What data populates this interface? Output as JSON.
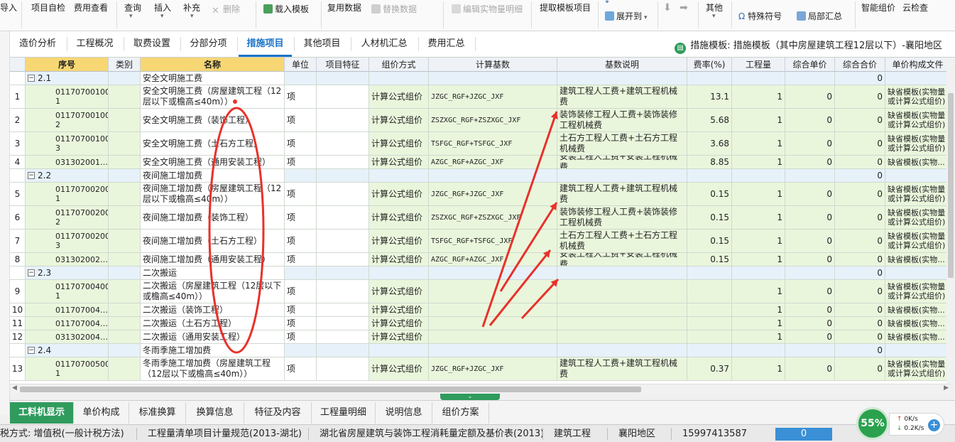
{
  "toolbar": {
    "items": [
      {
        "key": "import",
        "label": "导入",
        "disabled": false
      },
      {
        "key": "self_check",
        "label": "项目自检",
        "disabled": false
      },
      {
        "key": "fee_view",
        "label": "费用查看",
        "disabled": false
      },
      {
        "key": "query",
        "label": "查询",
        "disabled": false
      },
      {
        "key": "insert",
        "label": "插入",
        "disabled": false
      },
      {
        "key": "supplement",
        "label": "补充",
        "disabled": false
      },
      {
        "key": "delete",
        "label": "删除",
        "disabled": true
      },
      {
        "key": "load_template",
        "label": "载入模板",
        "disabled": false
      },
      {
        "key": "reuse_data",
        "label": "复用数据",
        "disabled": false
      },
      {
        "key": "replace_data",
        "label": "替换数据",
        "disabled": true
      },
      {
        "key": "edit_detail",
        "label": "编辑实物量明细",
        "disabled": true
      },
      {
        "key": "extract_template",
        "label": "提取模板项目",
        "disabled": false
      },
      {
        "key": "expand_to",
        "label": "展开到",
        "disabled": false
      },
      {
        "key": "other",
        "label": "其他",
        "disabled": false
      },
      {
        "key": "special_symbol",
        "label": "特殊符号",
        "disabled": false
      },
      {
        "key": "partial_summary",
        "label": "局部汇总",
        "disabled": false
      },
      {
        "key": "smart_pricing",
        "label": "智能组价",
        "disabled": false
      },
      {
        "key": "cloud_check",
        "label": "云检查",
        "disabled": false
      }
    ]
  },
  "tabs": {
    "items": [
      "造价分析",
      "工程概况",
      "取费设置",
      "分部分项",
      "措施项目",
      "其他项目",
      "人材机汇总",
      "费用汇总"
    ],
    "active_index": 4,
    "template_info": "措施模板: 措施模板（其中房屋建筑工程12层以下）-襄阳地区"
  },
  "grid": {
    "headers": [
      "序号",
      "类别",
      "名称",
      "单位",
      "项目特征",
      "组价方式",
      "计算基数",
      "基数说明",
      "费率(%)",
      "工程量",
      "综合单价",
      "综合合价",
      "单价构成文件"
    ],
    "highlight_headers": [
      0,
      2
    ],
    "rows": [
      {
        "type": "group",
        "seq": "2.1",
        "name": "安全文明施工费",
        "total": "0"
      },
      {
        "type": "item",
        "rn": "1",
        "seq": "01170700100\n1",
        "name": "安全文明施工费（房屋建筑工程（12层以下或檐高≤40m））",
        "unit": "项",
        "method": "计算公式组价",
        "base": "JZGC_RGF+JZGC_JXF",
        "desc": "建筑工程人工费+建筑工程机械费",
        "rate": "13.1",
        "qty": "1",
        "price": "0",
        "total": "0",
        "file": "缺省模板(实物量或计算公式组价)"
      },
      {
        "type": "item",
        "rn": "2",
        "seq": "01170700100\n2",
        "name": "安全文明施工费（装饰工程）",
        "unit": "项",
        "method": "计算公式组价",
        "base": "ZSZXGC_RGF+ZSZXGC_JXF",
        "desc": "装饰装修工程人工费+装饰装修工程机械费",
        "rate": "5.68",
        "qty": "1",
        "price": "0",
        "total": "0",
        "file": "缺省模板(实物量或计算公式组价)"
      },
      {
        "type": "item",
        "rn": "3",
        "seq": "01170700100\n3",
        "name": "安全文明施工费（土石方工程）",
        "unit": "项",
        "method": "计算公式组价",
        "base": "TSFGC_RGF+TSFGC_JXF",
        "desc": "土石方工程人工费+土石方工程机械费",
        "rate": "3.68",
        "qty": "1",
        "price": "0",
        "total": "0",
        "file": "缺省模板(实物量或计算公式组价)"
      },
      {
        "type": "item",
        "rn": "4",
        "seq": "031302001…",
        "name": "安全文明施工费（通用安装工程）",
        "unit": "项",
        "method": "计算公式组价",
        "base": "AZGC_RGF+AZGC_JXF",
        "desc": "安装工程人工费+安装工程机械费",
        "rate": "8.85",
        "qty": "1",
        "price": "0",
        "total": "0",
        "file": "缺省模板(实物..."
      },
      {
        "type": "group",
        "seq": "2.2",
        "name": "夜间施工增加费",
        "total": "0"
      },
      {
        "type": "item",
        "rn": "5",
        "seq": "01170700200\n1",
        "name": "夜间施工增加费（房屋建筑工程（12层以下或檐高≤40m））",
        "unit": "项",
        "method": "计算公式组价",
        "base": "JZGC_RGF+JZGC_JXF",
        "desc": "建筑工程人工费+建筑工程机械费",
        "rate": "0.15",
        "qty": "1",
        "price": "0",
        "total": "0",
        "file": "缺省模板(实物量或计算公式组价)"
      },
      {
        "type": "item",
        "rn": "6",
        "seq": "01170700200\n2",
        "name": "夜间施工增加费（装饰工程）",
        "unit": "项",
        "method": "计算公式组价",
        "base": "ZSZXGC_RGF+ZSZXGC_JXF",
        "desc": "装饰装修工程人工费+装饰装修工程机械费",
        "rate": "0.15",
        "qty": "1",
        "price": "0",
        "total": "0",
        "file": "缺省模板(实物量或计算公式组价)"
      },
      {
        "type": "item",
        "rn": "7",
        "seq": "01170700200\n3",
        "name": "夜间施工增加费（土石方工程）",
        "unit": "项",
        "method": "计算公式组价",
        "base": "TSFGC_RGF+TSFGC_JXF",
        "desc": "土石方工程人工费+土石方工程机械费",
        "rate": "0.15",
        "qty": "1",
        "price": "0",
        "total": "0",
        "file": "缺省模板(实物量或计算公式组价)"
      },
      {
        "type": "item",
        "rn": "8",
        "seq": "031302002…",
        "name": "夜间施工增加费（通用安装工程）",
        "unit": "项",
        "method": "计算公式组价",
        "base": "AZGC_RGF+AZGC_JXF",
        "desc": "安装工程人工费+安装工程机械费",
        "rate": "0.15",
        "qty": "1",
        "price": "0",
        "total": "0",
        "file": "缺省模板(实物..."
      },
      {
        "type": "group",
        "seq": "2.3",
        "name": "二次搬运",
        "total": "0"
      },
      {
        "type": "item",
        "rn": "9",
        "seq": "01170700400\n1",
        "name": "二次搬运（房屋建筑工程（12层以下或檐高≤40m））",
        "unit": "项",
        "method": "计算公式组价",
        "base": "",
        "desc": "",
        "rate": "",
        "qty": "1",
        "price": "0",
        "total": "0",
        "file": "缺省模板(实物量或计算公式组价)"
      },
      {
        "type": "item",
        "rn": "10",
        "seq": "011707004…",
        "name": "二次搬运（装饰工程）",
        "unit": "项",
        "method": "计算公式组价",
        "base": "",
        "desc": "",
        "rate": "",
        "qty": "1",
        "price": "0",
        "total": "0",
        "file": "缺省模板(实物..."
      },
      {
        "type": "item",
        "rn": "11",
        "seq": "011707004…",
        "name": "二次搬运（土石方工程）",
        "unit": "项",
        "method": "计算公式组价",
        "base": "",
        "desc": "",
        "rate": "",
        "qty": "1",
        "price": "0",
        "total": "0",
        "file": "缺省模板(实物..."
      },
      {
        "type": "item",
        "rn": "12",
        "seq": "031302004…",
        "name": "二次搬运（通用安装工程）",
        "unit": "项",
        "method": "计算公式组价",
        "base": "",
        "desc": "",
        "rate": "",
        "qty": "1",
        "price": "0",
        "total": "0",
        "file": "缺省模板(实物..."
      },
      {
        "type": "group",
        "seq": "2.4",
        "name": "冬雨季施工增加费",
        "total": "0"
      },
      {
        "type": "item",
        "rn": "13",
        "seq": "01170700500\n1",
        "name": "冬雨季施工增加费（房屋建筑工程（12层以下或檐高≤40m））",
        "unit": "项",
        "method": "计算公式组价",
        "base": "JZGC_RGF+JZGC_JXF",
        "desc": "建筑工程人工费+建筑工程机械费",
        "rate": "0.37",
        "qty": "1",
        "price": "0",
        "total": "0",
        "file": "缺省模板(实物量或计算公式组价)"
      }
    ]
  },
  "bottom_tabs": {
    "items": [
      "工料机显示",
      "单价构成",
      "标准换算",
      "换算信息",
      "特征及内容",
      "工程量明细",
      "说明信息",
      "组价方案"
    ],
    "active_index": 0
  },
  "status": {
    "tax_method": "税方式: 增值税(一般计税方法)",
    "spec": "工程量清单项目计量规范(2013-湖北)",
    "quota": "湖北省房屋建筑与装饰工程消耗量定额及基价表(2013)",
    "project_type": "建筑工程",
    "region": "襄阳地区",
    "phone": "15997413587",
    "progress_value": "0"
  },
  "speed_widget": {
    "percent": "55%",
    "upload": "0K/s",
    "download": "0.2K/s"
  },
  "annotation_color": "#e8312a"
}
